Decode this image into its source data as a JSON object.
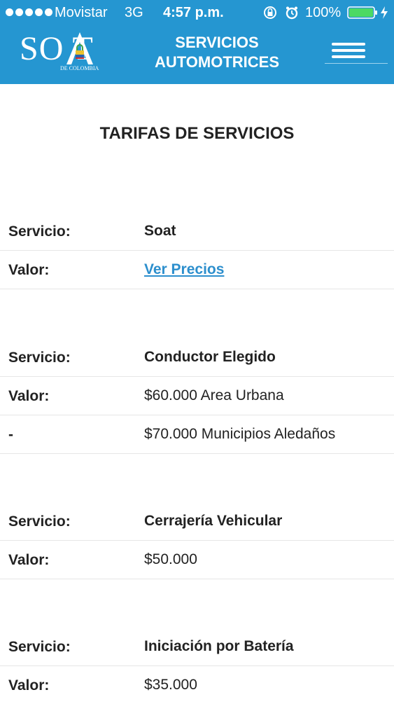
{
  "status_bar": {
    "carrier": "Movistar",
    "network": "3G",
    "time": "4:57 p.m.",
    "battery": "100%",
    "icons": [
      "signal-dots-icon",
      "orientation-lock-icon",
      "alarm-icon",
      "battery-icon",
      "charging-bolt-icon"
    ]
  },
  "header": {
    "logo_text": "SO T",
    "logo_subtext": "DE COLOMBIA",
    "title_line1": "SERVICIOS",
    "title_line2": "AUTOMOTRICES",
    "menu_icon": "hamburger-menu-icon",
    "background_color": "#2596d1"
  },
  "page": {
    "title": "TARIFAS DE SERVICIOS"
  },
  "services": [
    {
      "service_label": "Servicio:",
      "service_name": "Soat",
      "value_label": "Valor:",
      "value": "Ver Precios",
      "value_is_link": true,
      "link_color": "#2d8fcd"
    },
    {
      "service_label": "Servicio:",
      "service_name": "Conductor Elegido",
      "value_label": "Valor:",
      "value": "$60.000 Area Urbana",
      "extra_label": "-",
      "extra_value": "$70.000 Municipios Aledaños"
    },
    {
      "service_label": "Servicio:",
      "service_name": "Cerrajería Vehicular",
      "value_label": "Valor:",
      "value": "$50.000"
    },
    {
      "service_label": "Servicio:",
      "service_name": "Iniciación por Batería",
      "value_label": "Valor:",
      "value": "$35.000"
    }
  ]
}
